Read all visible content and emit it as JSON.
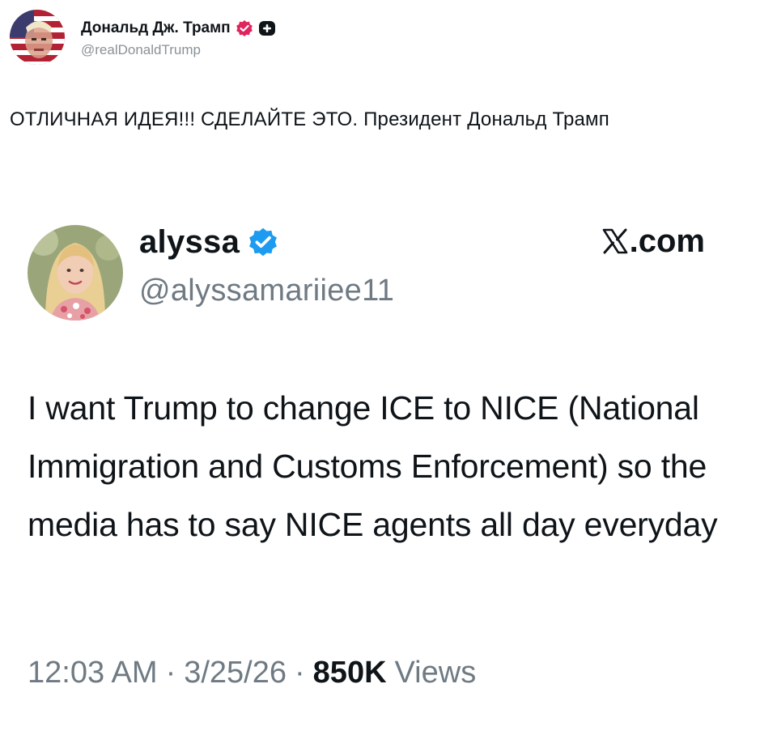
{
  "post": {
    "author_name": "Дональд Дж. Трамп",
    "author_handle": "@realDonaldTrump",
    "verified_badge": "verified-badge-icon",
    "plus_badge": "plus-badge-icon",
    "text": "ОТЛИЧНАЯ ИДЕЯ!!! СДЕЛАЙТЕ ЭТО. Президент Дональд Трамп"
  },
  "embedded_tweet": {
    "author_name": "alyssa",
    "author_handle": "@alyssamariiee11",
    "site_label": ".com",
    "site_logo": "x-logo-icon",
    "body": "I want Trump to change ICE to NICE (National Immigration and Customs Enforcement) so the media has to say NICE agents all day everyday",
    "time": "12:03 AM",
    "date": "3/25/26",
    "separator": "·",
    "views_count": "850K",
    "views_label": "Views"
  },
  "colors": {
    "text_primary": "#0f1419",
    "text_secondary": "#6f7a83",
    "verified_blue": "#1d9bf0",
    "verified_pink": "#e0245e",
    "background": "#ffffff"
  }
}
